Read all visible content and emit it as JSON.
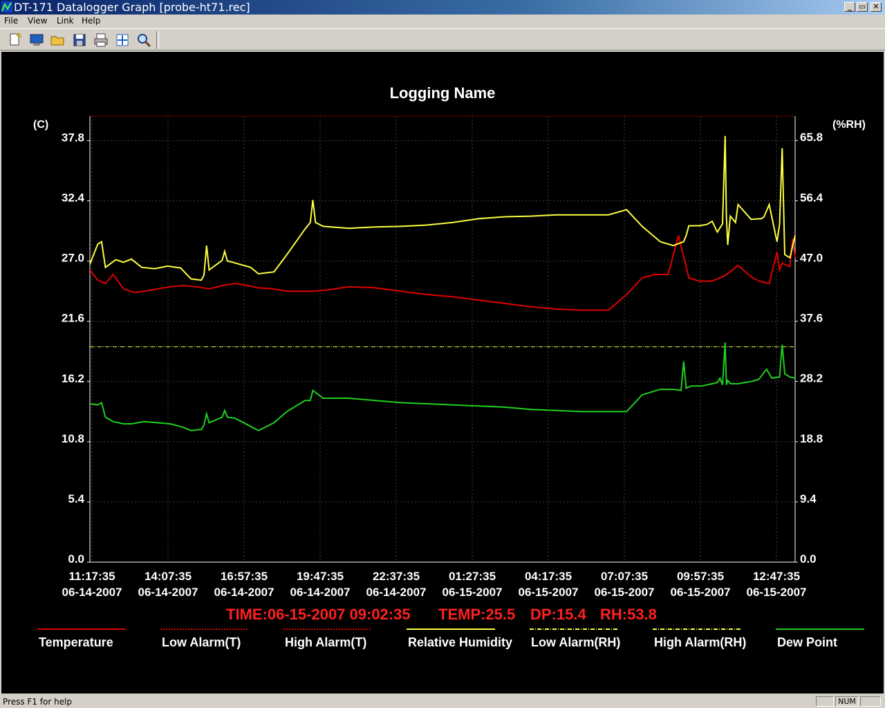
{
  "window": {
    "title": "DT-171 Datalogger Graph [probe-ht71.rec]",
    "min": "_",
    "max": "▭",
    "close": "✕"
  },
  "menu": [
    "File",
    "View",
    "Link",
    "Help"
  ],
  "toolbar": [
    "new-icon",
    "display-icon",
    "open-icon",
    "save-icon",
    "print-icon",
    "fit-icon",
    "zoom-icon"
  ],
  "colors": {
    "temperature": "#e00000",
    "humidity": "#ffff40",
    "dewpoint": "#20d020",
    "readout": "#ff2020"
  },
  "chart_data": {
    "type": "line",
    "title": "Logging Name",
    "ylabel_left": "(C)",
    "ylabel_right": "(%RH)",
    "yticks_left": [
      "37.8",
      "32.4",
      "27.0",
      "21.6",
      "16.2",
      "10.8",
      "5.4",
      "0.0"
    ],
    "yticks_right": [
      "65.8",
      "56.4",
      "47.0",
      "37.6",
      "28.2",
      "18.8",
      "9.4",
      "0.0"
    ],
    "ylim_left": [
      0,
      40
    ],
    "ylim_right": [
      0,
      69.6
    ],
    "x_ticks": [
      {
        "time": "11:17:35",
        "date": "06-14-2007"
      },
      {
        "time": "14:07:35",
        "date": "06-14-2007"
      },
      {
        "time": "16:57:35",
        "date": "06-14-2007"
      },
      {
        "time": "19:47:35",
        "date": "06-14-2007"
      },
      {
        "time": "22:37:35",
        "date": "06-14-2007"
      },
      {
        "time": "01:27:35",
        "date": "06-15-2007"
      },
      {
        "time": "04:17:35",
        "date": "06-15-2007"
      },
      {
        "time": "07:07:35",
        "date": "06-15-2007"
      },
      {
        "time": "09:57:35",
        "date": "06-15-2007"
      },
      {
        "time": "12:47:35",
        "date": "06-15-2007"
      }
    ],
    "x_hours_range": [
      0,
      27.2
    ],
    "high_alarm_temp": 40,
    "high_alarm_rh": 33.6,
    "series": [
      {
        "name": "Temperature",
        "key": "temp",
        "axis": "left",
        "x": [
          0,
          0.3,
          0.6,
          0.9,
          1.3,
          1.7,
          2.1,
          2.6,
          3.1,
          3.6,
          4.1,
          4.6,
          5.1,
          5.6,
          6.1,
          6.5,
          7.1,
          7.6,
          8.1,
          8.6,
          9.1,
          10.0,
          11,
          12,
          13,
          14,
          15,
          16,
          17,
          18,
          19,
          20,
          20.7,
          21.3,
          21.8,
          22.3,
          22.7,
          23.1,
          23.5,
          24.0,
          24.5,
          25,
          25.5,
          25.8,
          26.2,
          26.5,
          26.6,
          26.7,
          27,
          27.1,
          27.2
        ],
        "values": [
          26.2,
          25.3,
          25.0,
          25.8,
          24.5,
          24.2,
          24.3,
          24.5,
          24.7,
          24.8,
          24.7,
          24.5,
          24.8,
          25.0,
          24.8,
          24.6,
          24.5,
          24.3,
          24.3,
          24.3,
          24.4,
          24.7,
          24.6,
          24.3,
          24.0,
          23.8,
          23.5,
          23.2,
          22.9,
          22.7,
          22.6,
          22.6,
          24.0,
          25.5,
          25.8,
          25.8,
          29.3,
          25.5,
          25.2,
          25.2,
          25.7,
          26.6,
          25.6,
          25.2,
          25.0,
          27.8,
          26.2,
          26.8,
          26.5,
          29.0,
          27.3
        ]
      },
      {
        "name": "Low Alarm(T)",
        "key": "lowt",
        "axis": "left",
        "x": [],
        "values": []
      },
      {
        "name": "High Alarm(T)",
        "key": "hight",
        "axis": "left",
        "x": [],
        "values": []
      },
      {
        "name": "Relative Humidity",
        "key": "rh",
        "axis": "right",
        "x": [
          0,
          0.3,
          0.45,
          0.6,
          1.0,
          1.3,
          1.6,
          2.0,
          2.5,
          3.0,
          3.5,
          3.9,
          4.3,
          4.4,
          4.5,
          4.6,
          5.1,
          5.2,
          5.3,
          5.5,
          6.2,
          6.5,
          7.1,
          7.6,
          8.3,
          8.5,
          8.6,
          8.7,
          9.0,
          10,
          11,
          12,
          13,
          14,
          15,
          16,
          17,
          18,
          19,
          20,
          20.7,
          21.3,
          22.0,
          22.5,
          22.9,
          23.0,
          23.1,
          23.5,
          23.8,
          24.0,
          24.2,
          24.4,
          24.5,
          24.55,
          24.6,
          24.7,
          24.9,
          25.0,
          25.5,
          25.9,
          26.0,
          26.2,
          26.5,
          26.6,
          26.7,
          26.8,
          27.0,
          27.2
        ],
        "values": [
          46.5,
          49.6,
          50.0,
          46.0,
          47.2,
          46.8,
          47.3,
          46.0,
          45.8,
          46.2,
          45.9,
          44.2,
          44.0,
          44.8,
          49.4,
          45.6,
          47.1,
          48.5,
          47.0,
          46.8,
          46.0,
          45.0,
          45.3,
          48.0,
          52.0,
          53.0,
          56.5,
          53.0,
          52.4,
          52.1,
          52.3,
          52.4,
          52.6,
          53.0,
          53.6,
          53.9,
          54.0,
          54.2,
          54.2,
          54.2,
          55.0,
          52.4,
          50.0,
          49.4,
          50.0,
          51.0,
          52.5,
          52.5,
          52.7,
          53.2,
          51.5,
          52.8,
          66.5,
          54.0,
          49.5,
          54.0,
          53.0,
          55.8,
          53.5,
          53.6,
          53.9,
          55.8,
          50.0,
          52.7,
          64.6,
          48.0,
          47.5,
          51.0
        ]
      },
      {
        "name": "Low Alarm(RH)",
        "key": "lowrh",
        "axis": "right",
        "x": [],
        "values": []
      },
      {
        "name": "High Alarm(RH)",
        "key": "highrh",
        "axis": "right",
        "x": [],
        "values": []
      },
      {
        "name": "Dew Point",
        "key": "dew",
        "axis": "left",
        "x": [
          0,
          0.3,
          0.45,
          0.6,
          0.9,
          1.3,
          1.6,
          2.1,
          2.6,
          3.1,
          3.6,
          3.9,
          4.3,
          4.4,
          4.5,
          4.6,
          5.1,
          5.2,
          5.3,
          5.6,
          6.1,
          6.5,
          7.1,
          7.6,
          8.3,
          8.5,
          8.6,
          9.0,
          10,
          11,
          12,
          13,
          14,
          15,
          16,
          17,
          18,
          19,
          20,
          20.7,
          21.3,
          22.0,
          22.5,
          22.8,
          22.9,
          23.0,
          23.2,
          23.6,
          24.0,
          24.2,
          24.3,
          24.4,
          24.5,
          24.55,
          24.6,
          24.7,
          25.0,
          25.5,
          25.8,
          26.1,
          26.3,
          26.6,
          26.7,
          26.8,
          27.0,
          27.2
        ],
        "values": [
          14.2,
          14.1,
          14.3,
          13.0,
          12.6,
          12.4,
          12.4,
          12.6,
          12.5,
          12.4,
          12.1,
          11.8,
          11.9,
          12.3,
          13.3,
          12.5,
          13.0,
          13.6,
          13.0,
          12.9,
          12.3,
          11.8,
          12.5,
          13.5,
          14.5,
          14.5,
          15.4,
          14.7,
          14.7,
          14.5,
          14.3,
          14.2,
          14.1,
          14.0,
          13.9,
          13.7,
          13.6,
          13.5,
          13.5,
          13.5,
          15.0,
          15.5,
          15.5,
          15.4,
          18.0,
          15.6,
          15.8,
          15.8,
          16.0,
          16.1,
          16.5,
          15.9,
          19.7,
          15.9,
          16.3,
          16.0,
          16.0,
          16.2,
          16.4,
          17.3,
          16.5,
          16.6,
          19.5,
          16.9,
          16.6,
          16.5
        ]
      }
    ],
    "legend": [
      "Temperature",
      "Low Alarm(T)",
      "High Alarm(T)",
      "Relative Humidity",
      "Low Alarm(RH)",
      "High Alarm(RH)",
      "Dew Point"
    ],
    "legend_placement": "bottom",
    "grid": true
  },
  "readout": {
    "time": "TIME:06-15-2007 09:02:35",
    "temp": "TEMP:25.5",
    "dp": "DP:15.4",
    "rh": "RH:53.8"
  },
  "status": {
    "help": "Press F1 for help",
    "num": "NUM"
  }
}
